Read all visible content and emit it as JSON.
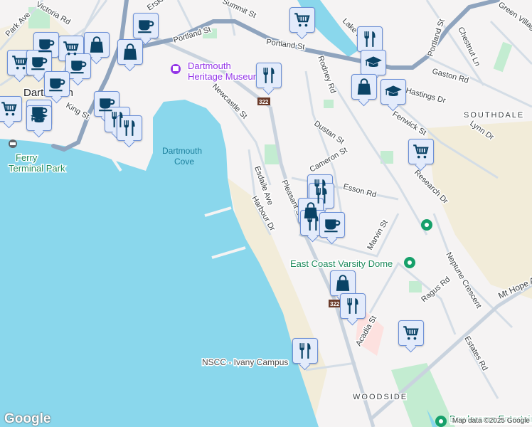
{
  "map": {
    "colors": {
      "water": "#8ad7ec",
      "land": "#f5f3f3",
      "park": "#c3ecd1",
      "highway": "#8fa4be",
      "road": "#d4dde6",
      "sand": "#f2ecd9",
      "marker_icon": "#0a4366",
      "marker_bg": "#e3ebfb",
      "museum": "#9334e6",
      "poi_green": "#16a06a"
    },
    "labels": {
      "portland_st_1": "Portland St",
      "portland_st_2": "Portland St",
      "victoria_rd": "Victoria Rd",
      "park_ave": "Park Ave",
      "erskine": "Erskine St",
      "summit_st": "Summit St",
      "king_st": "King St",
      "newcastle_st": "Newcastle St",
      "dartmouth": "Dartmouth",
      "museum": "Dartmouth Heritage Museum",
      "cove_1": "Dartmouth",
      "cove_2": "Cove",
      "ferry_1": "Ferry",
      "ferry_2": "Terminal Park",
      "lake": "Lake Banook",
      "rodney_rd": "Rodney Rd",
      "chestnut_ln": "Chestnut Ln",
      "green_village": "Green Village Ln",
      "gaston_rd": "Gaston Rd",
      "hastings_dr": "Hastings Dr",
      "fenwick_st": "Fenwick St",
      "southdale": "SOUTHDALE",
      "lynn_dr": "Lynn Dr",
      "dustan_st": "Dustan St",
      "cameron_st": "Cameron St",
      "esdaile_ave": "Esdaile Ave",
      "harbour_dr": "Harbour Dr",
      "pleasant_st": "Pleasant St",
      "esson_rd": "Esson Rd",
      "research_dr": "Research Dr",
      "marvin_st": "Marvin St",
      "varsity_dome": "East Coast Varsity Dome",
      "neptune_cres": "Neptune Crescent",
      "ragus_rd": "Ragus Rd",
      "mt_hope": "Mt Hope Ave",
      "acadia_st": "Acadia St",
      "estates_rd": "Estates Rd",
      "nscc": "NSCC - Ivany Campus",
      "woodside": "WOODSIDE",
      "route_1": "322",
      "route_2": "322",
      "bowlarama": "Bowlarama Entertainment"
    },
    "markers": [
      "cart",
      "cup",
      "bag",
      "bag",
      "cart",
      "cup",
      "cart",
      "cup",
      "cup",
      "cup",
      "cart",
      "cup",
      "cap",
      "cup",
      "fork",
      "fork",
      "fork",
      "cap",
      "bag",
      "cap",
      "fork",
      "cart",
      "fork",
      "fork",
      "bag",
      "fork",
      "cup",
      "bag",
      "fork",
      "cart",
      "fork"
    ],
    "google_logo": "Google",
    "attribution": "Map data ©2025 Google"
  }
}
